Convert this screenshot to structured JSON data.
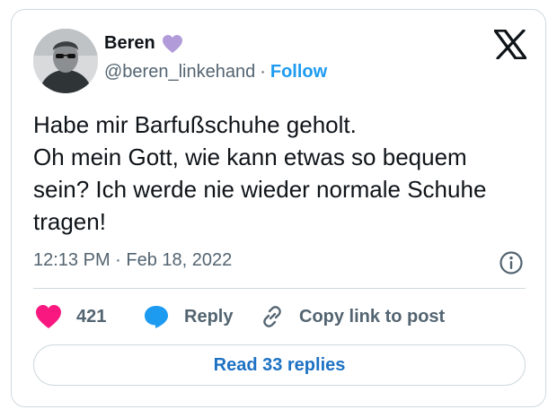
{
  "author": {
    "display_name": "Beren",
    "handle": "@beren_linkehand",
    "separator": "·",
    "follow_label": "Follow",
    "badge_icon": "purple-heart-icon",
    "badge_color": "#b19cd9"
  },
  "tweet": {
    "text": "Habe mir Barfußschuhe geholt.\nOh mein Gott, wie kann etwas so bequem sein? Ich werde nie wieder normale Schuhe tragen!",
    "timestamp": "12:13 PM · Feb 18, 2022"
  },
  "actions": {
    "like_count": "421",
    "reply_label": "Reply",
    "copy_label": "Copy link to post"
  },
  "read_replies_label": "Read 33 replies",
  "colors": {
    "like": "#f91880",
    "reply": "#1d9bf0",
    "link": "#1d9bf0",
    "border": "#cfd9de",
    "muted": "#536471"
  }
}
